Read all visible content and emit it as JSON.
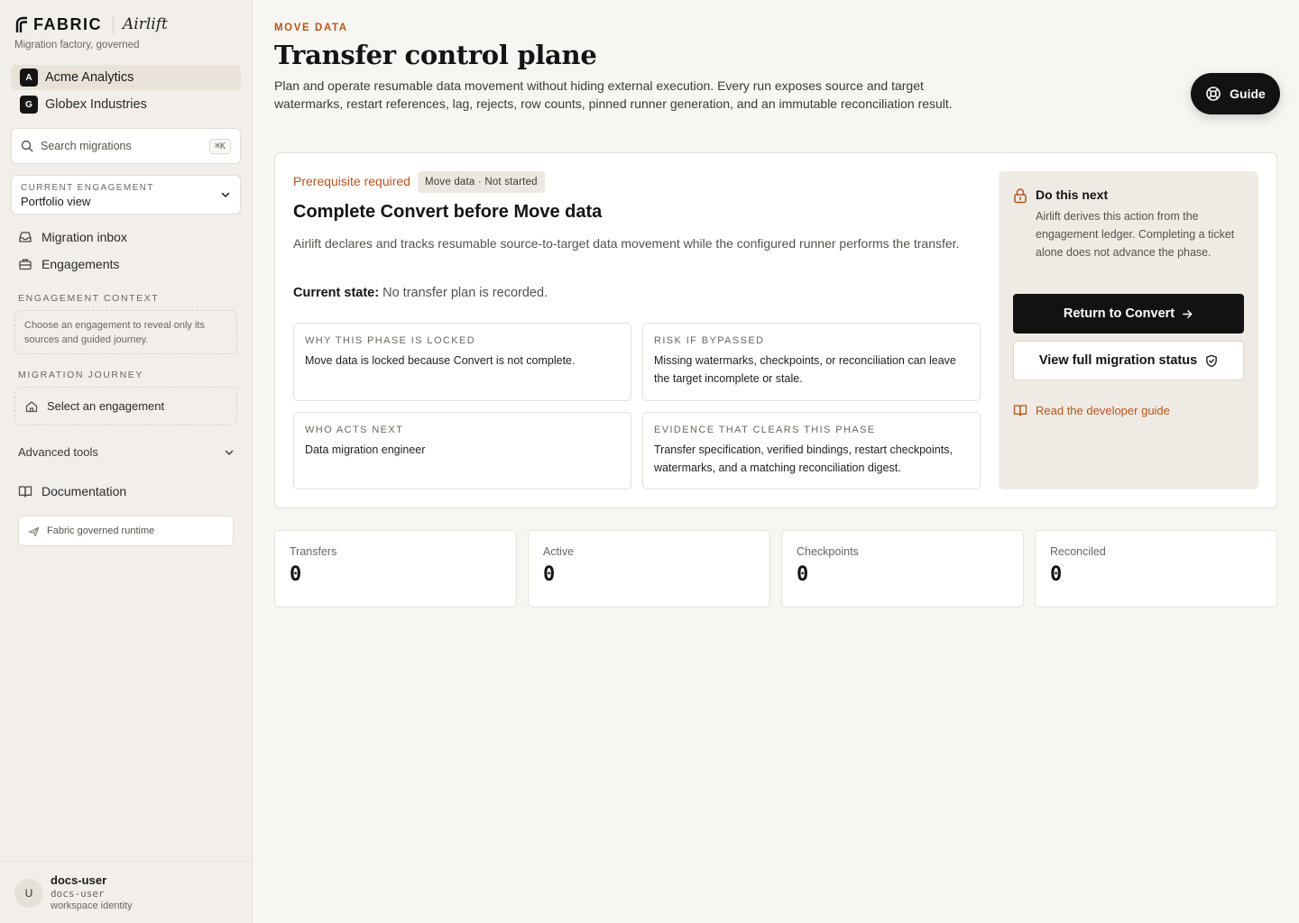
{
  "brand": {
    "logo_text": "FABRIC",
    "product": "Airlift",
    "tagline": "Migration factory, governed"
  },
  "tenants": [
    {
      "badge": "A",
      "name": "Acme Analytics"
    },
    {
      "badge": "G",
      "name": "Globex Industries"
    }
  ],
  "search": {
    "placeholder": "Search migrations",
    "shortcut": "⌘K"
  },
  "engagement": {
    "label": "CURRENT ENGAGEMENT",
    "value": "Portfolio view"
  },
  "nav": {
    "inbox": "Migration inbox",
    "engagements": "Engagements"
  },
  "context": {
    "label": "ENGAGEMENT CONTEXT",
    "text": "Choose an engagement to reveal only its sources and guided journey."
  },
  "journey": {
    "label": "MIGRATION JOURNEY",
    "item": "Select an engagement"
  },
  "advanced": {
    "label": "Advanced tools"
  },
  "docs": {
    "label": "Documentation"
  },
  "runtime": {
    "label": "Fabric governed runtime"
  },
  "user": {
    "initial": "U",
    "name": "docs-user",
    "handle": "docs-user",
    "role": "workspace identity"
  },
  "page": {
    "eyebrow": "MOVE DATA",
    "title": "Transfer control plane",
    "description": "Plan and operate resumable data movement without hiding external execution. Every run exposes source and target watermarks, restart references, lag, rejects, row counts, pinned runner generation, and an immutable reconciliation result."
  },
  "guide_button": "Guide",
  "card": {
    "prereq": "Prerequisite required",
    "pill": "Move data · Not started",
    "title": "Complete Convert before Move data",
    "description": "Airlift declares and tracks resumable source-to-target data movement while the configured runner performs the transfer.",
    "state_label": "Current state:",
    "state_value": " No transfer plan is recorded.",
    "info": [
      {
        "label": "WHY THIS PHASE IS LOCKED",
        "text": "Move data is locked because Convert is not complete."
      },
      {
        "label": "RISK IF BYPASSED",
        "text": "Missing watermarks, checkpoints, or reconciliation can leave the target incomplete or stale."
      },
      {
        "label": "WHO ACTS NEXT",
        "text": "Data migration engineer"
      },
      {
        "label": "EVIDENCE THAT CLEARS THIS PHASE",
        "text": "Transfer specification, verified bindings, restart checkpoints, watermarks, and a matching reconciliation digest."
      }
    ]
  },
  "next": {
    "title": "Do this next",
    "description": "Airlift derives this action from the engagement ledger. Completing a ticket alone does not advance the phase.",
    "primary": "Return to Convert",
    "secondary": "View full migration status",
    "link": "Read the developer guide"
  },
  "stats": [
    {
      "label": "Transfers",
      "value": "0"
    },
    {
      "label": "Active",
      "value": "0"
    },
    {
      "label": "Checkpoints",
      "value": "0"
    },
    {
      "label": "Reconciled",
      "value": "0"
    }
  ],
  "colors": {
    "accent": "#b5541c",
    "ink": "#121212",
    "sidebar": "#f2efea",
    "page": "#f8f6f2"
  }
}
